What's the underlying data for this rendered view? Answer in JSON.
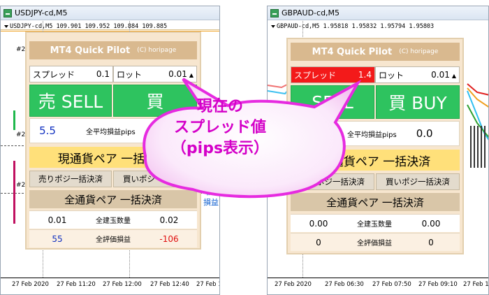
{
  "left_window": {
    "title": "USDJPY-cd,M5",
    "info_line": "USDJPY-cd,M5  109.901 109.952 109.884 109.885",
    "x_axis": [
      "27 Feb 2020",
      "27 Feb 11:20",
      "27 Feb 12:00",
      "27 Feb 12:40",
      "27 Feb 13:"
    ],
    "side_marks": [
      "#2",
      "#2",
      "#2"
    ],
    "side_text": [
      "損",
      "損益"
    ]
  },
  "right_window": {
    "title": "GBPAUD-cd,M5",
    "info_line": "GBPAUD-cd,M5  1.95818 1.95832 1.95794 1.95803",
    "x_axis": [
      "27 Feb 2020",
      "27 Feb 06:30",
      "27 Feb 07:50",
      "27 Feb 09:10",
      "27 Feb 10:"
    ]
  },
  "left_panel": {
    "title": "MT4 Quick Pilot",
    "copyright": "(C) horipage",
    "spread_label": "スプレッド",
    "spread_value": "0.1",
    "lot_label": "ロット",
    "lot_value": "0.01",
    "sell_label": "売 SELL",
    "buy_label": "買",
    "avg_pips_value": "5.5",
    "avg_pips_label": "全平均損益pips",
    "close_pair": "現通貨ペア 一括決済",
    "sell_close": "売りポジ一括決済",
    "buy_close": "買いポジ一括決済",
    "all_pairs_head": "全通貨ペア 一括決済",
    "lots_left": "0.01",
    "lots_label": "全建玉数量",
    "lots_right": "0.02",
    "pl_left": "55",
    "pl_label": "全評価損益",
    "pl_right": "-106"
  },
  "right_panel": {
    "title": "MT4 Quick Pilot",
    "copyright": "(C) horipage",
    "spread_label": "スプレッド",
    "spread_value": "1.4",
    "lot_label": "ロット",
    "lot_value": "0.01",
    "sell_label": "SELL",
    "buy_label": "買 BUY",
    "avg_pips_left": "0",
    "avg_pips_label": "全平均損益pips",
    "avg_pips_right": "0.0",
    "close_pair": "現通貨ペア 一括決済",
    "sell_close": "売りポジ一括決済",
    "buy_close": "買いポジ一括決済",
    "all_pairs_head": "全通貨ペア 一括決済",
    "lots_left": "0.00",
    "lots_label": "全建玉数量",
    "lots_right": "0.00",
    "pl_left": "0",
    "pl_label": "全評価損益",
    "pl_right": "0"
  },
  "callout": {
    "line1": "現在の",
    "line2": "スプレッド値",
    "line3": "（pips表示）"
  },
  "colors": {
    "panel_bg": "#f7e6cf",
    "title_bg": "#d9b98f",
    "green": "#2ec35f",
    "spread_red": "#f31a1a",
    "yellow": "#ffe07a",
    "callout_stroke": "#e62be0"
  }
}
